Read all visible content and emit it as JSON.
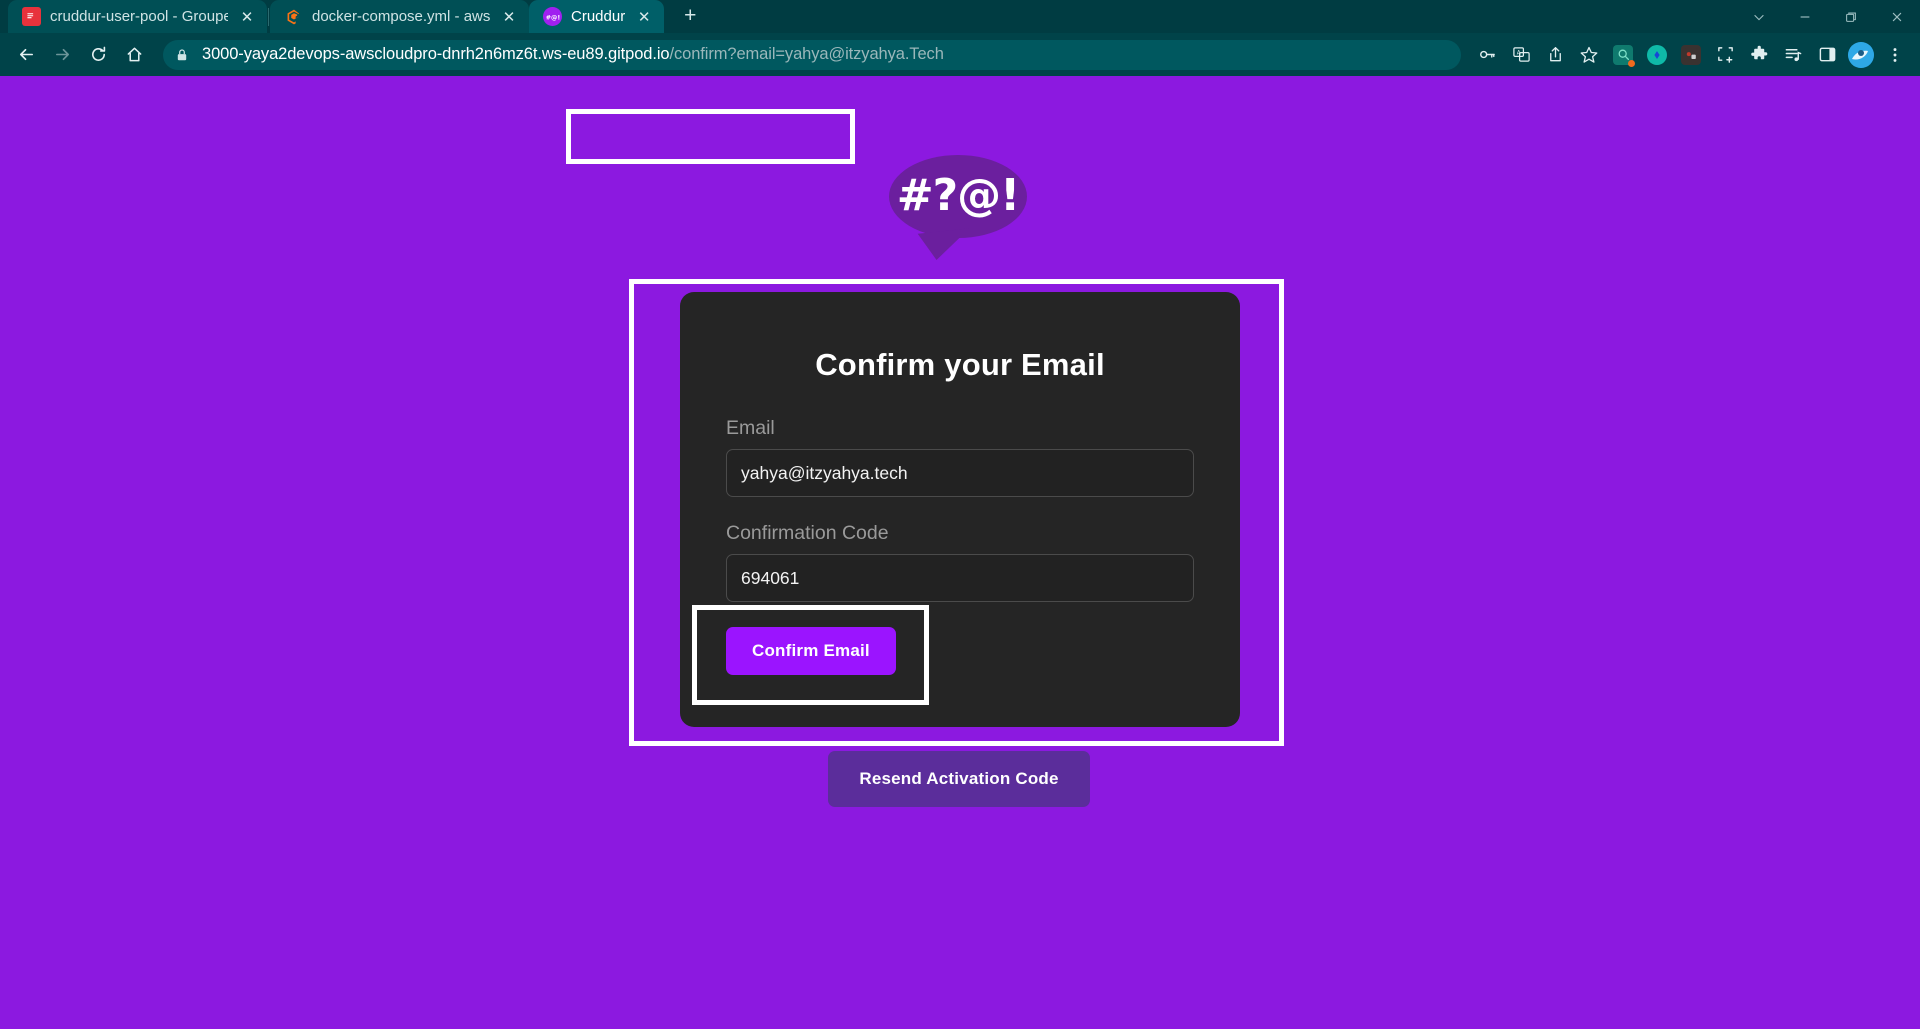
{
  "browser": {
    "tabs": [
      {
        "title": "cruddur-user-pool - Groupes d'u",
        "favicon": "aws-cognito-icon",
        "active": false,
        "close_label": "✕"
      },
      {
        "title": "docker-compose.yml - aws-cloud",
        "favicon": "gitpod-icon",
        "active": false,
        "close_label": "✕"
      },
      {
        "title": "Cruddur",
        "favicon": "cruddur-icon",
        "active": true,
        "close_label": "✕"
      }
    ],
    "new_tab_label": "+",
    "window_controls": [
      "chevron-down-icon",
      "minimize-icon",
      "maximize-icon",
      "close-icon"
    ],
    "nav": {
      "back_label": "←",
      "forward_label": "→",
      "reload_label": "⟳",
      "home_label": "⌂"
    },
    "omnibox": {
      "lock_icon": "lock-icon",
      "url_host": "3000-yaya2devops-awscloudpro-dnrh2n6mz6t.ws-eu89.gitpod.io",
      "url_path": "/confirm?email=yahya@itzyahya.Tech",
      "full_url": "3000-yaya2devops-awscloudpro-dnrh2n6mz6t.ws-eu89.gitpod.io/confirm?email=yahya@itzyahya.Tech"
    },
    "toolbar_icons": [
      "password-key-icon",
      "translate-icon",
      "share-icon",
      "bookmark-star-icon",
      "extension-search-icon",
      "extension-diamond-icon",
      "extension-recorder-icon",
      "screenshot-crop-icon",
      "extensions-puzzle-icon",
      "reading-playlist-icon",
      "side-panel-icon",
      "profile-avatar-icon",
      "chrome-menu-icon"
    ]
  },
  "page": {
    "background_color": "#8c19e0",
    "logo": {
      "name": "cruddur-speech-bubble-logo",
      "text": "#?@!",
      "bubble_color": "#6b1f9e"
    },
    "card": {
      "title": "Confirm your Email",
      "background_color": "#252525",
      "fields": [
        {
          "label": "Email",
          "value": "yahya@itzyahya.tech",
          "placeholder": "Email",
          "name": "email-field"
        },
        {
          "label": "Confirmation Code",
          "value": "694061",
          "placeholder": "Confirmation Code",
          "name": "confirmation-code-field"
        }
      ],
      "confirm_button": {
        "label": "Confirm Email",
        "color": "#9b14ff"
      }
    },
    "resend_button": {
      "label": "Resend Activation Code",
      "color": "#5b2d9b"
    },
    "annotations": [
      {
        "name": "url-highlight-box",
        "color": "#ffffff"
      },
      {
        "name": "card-highlight-box",
        "color": "#ffffff"
      },
      {
        "name": "confirm-button-highlight-box",
        "color": "#ffffff"
      }
    ]
  }
}
